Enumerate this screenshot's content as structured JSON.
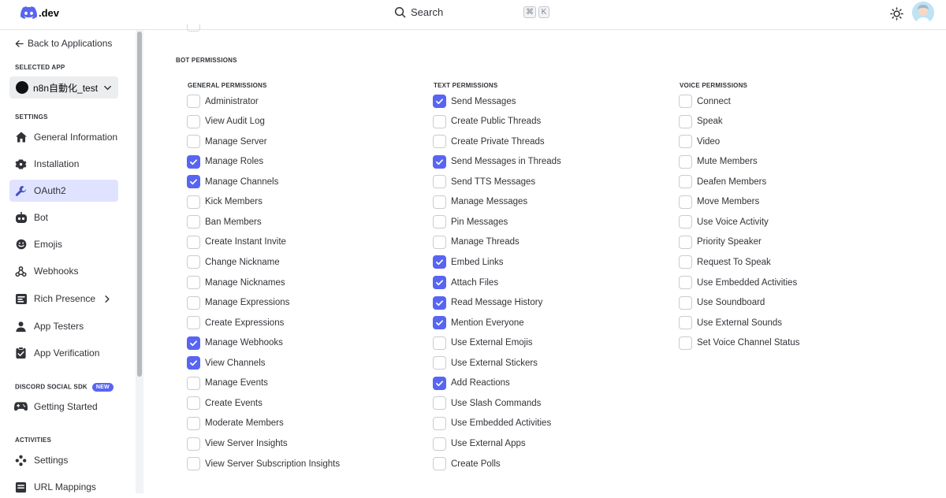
{
  "topbar": {
    "logo_text": ".dev",
    "search_label": "Search",
    "shortcut_keys": [
      "⌘",
      "K"
    ]
  },
  "sidebar": {
    "back_label": "Back to Applications",
    "selected_app_label": "SELECTED APP",
    "selected_app_name": "n8n自動化_test",
    "settings_label": "SETTINGS",
    "settings_items": [
      {
        "label": "General Information",
        "icon": "home-icon",
        "active": false
      },
      {
        "label": "Installation",
        "icon": "gear-icon",
        "active": false
      },
      {
        "label": "OAuth2",
        "icon": "wrench-icon",
        "active": true
      },
      {
        "label": "Bot",
        "icon": "bot-icon",
        "active": false
      },
      {
        "label": "Emojis",
        "icon": "emoji-icon",
        "active": false
      },
      {
        "label": "Webhooks",
        "icon": "webhook-icon",
        "active": false
      },
      {
        "label": "Rich Presence",
        "icon": "rich-presence-icon",
        "active": false
      },
      {
        "label": "App Testers",
        "icon": "person-icon",
        "active": false
      },
      {
        "label": "App Verification",
        "icon": "clipboard-check-icon",
        "active": false
      }
    ],
    "social_sdk_label": "DISCORD SOCIAL SDK",
    "new_badge": "NEW",
    "social_items": [
      {
        "label": "Getting Started",
        "icon": "gamepad-icon"
      }
    ],
    "activities_label": "ACTIVITIES",
    "activities_items": [
      {
        "label": "Settings",
        "icon": "dpad-icon"
      },
      {
        "label": "URL Mappings",
        "icon": "url-icon"
      }
    ]
  },
  "main": {
    "bot_permissions_title": "BOT PERMISSIONS",
    "columns": [
      {
        "title": "GENERAL PERMISSIONS",
        "items": [
          {
            "label": "Administrator",
            "checked": false
          },
          {
            "label": "View Audit Log",
            "checked": false
          },
          {
            "label": "Manage Server",
            "checked": false
          },
          {
            "label": "Manage Roles",
            "checked": true
          },
          {
            "label": "Manage Channels",
            "checked": true
          },
          {
            "label": "Kick Members",
            "checked": false
          },
          {
            "label": "Ban Members",
            "checked": false
          },
          {
            "label": "Create Instant Invite",
            "checked": false
          },
          {
            "label": "Change Nickname",
            "checked": false
          },
          {
            "label": "Manage Nicknames",
            "checked": false
          },
          {
            "label": "Manage Expressions",
            "checked": false
          },
          {
            "label": "Create Expressions",
            "checked": false
          },
          {
            "label": "Manage Webhooks",
            "checked": true
          },
          {
            "label": "View Channels",
            "checked": true
          },
          {
            "label": "Manage Events",
            "checked": false
          },
          {
            "label": "Create Events",
            "checked": false
          },
          {
            "label": "Moderate Members",
            "checked": false
          },
          {
            "label": "View Server Insights",
            "checked": false
          },
          {
            "label": "View Server Subscription Insights",
            "checked": false
          }
        ]
      },
      {
        "title": "TEXT PERMISSIONS",
        "items": [
          {
            "label": "Send Messages",
            "checked": true
          },
          {
            "label": "Create Public Threads",
            "checked": false
          },
          {
            "label": "Create Private Threads",
            "checked": false
          },
          {
            "label": "Send Messages in Threads",
            "checked": true
          },
          {
            "label": "Send TTS Messages",
            "checked": false
          },
          {
            "label": "Manage Messages",
            "checked": false
          },
          {
            "label": "Pin Messages",
            "checked": false
          },
          {
            "label": "Manage Threads",
            "checked": false
          },
          {
            "label": "Embed Links",
            "checked": true
          },
          {
            "label": "Attach Files",
            "checked": true
          },
          {
            "label": "Read Message History",
            "checked": true
          },
          {
            "label": "Mention Everyone",
            "checked": true
          },
          {
            "label": "Use External Emojis",
            "checked": false
          },
          {
            "label": "Use External Stickers",
            "checked": false
          },
          {
            "label": "Add Reactions",
            "checked": true
          },
          {
            "label": "Use Slash Commands",
            "checked": false
          },
          {
            "label": "Use Embedded Activities",
            "checked": false
          },
          {
            "label": "Use External Apps",
            "checked": false
          },
          {
            "label": "Create Polls",
            "checked": false
          }
        ]
      },
      {
        "title": "VOICE PERMISSIONS",
        "items": [
          {
            "label": "Connect",
            "checked": false
          },
          {
            "label": "Speak",
            "checked": false
          },
          {
            "label": "Video",
            "checked": false
          },
          {
            "label": "Mute Members",
            "checked": false
          },
          {
            "label": "Deafen Members",
            "checked": false
          },
          {
            "label": "Move Members",
            "checked": false
          },
          {
            "label": "Use Voice Activity",
            "checked": false
          },
          {
            "label": "Priority Speaker",
            "checked": false
          },
          {
            "label": "Request To Speak",
            "checked": false
          },
          {
            "label": "Use Embedded Activities",
            "checked": false
          },
          {
            "label": "Use Soundboard",
            "checked": false
          },
          {
            "label": "Use External Sounds",
            "checked": false
          },
          {
            "label": "Set Voice Channel Status",
            "checked": false
          }
        ]
      }
    ]
  },
  "colors": {
    "accent": "#5865f2",
    "active_nav_bg": "#e0e3ff"
  }
}
